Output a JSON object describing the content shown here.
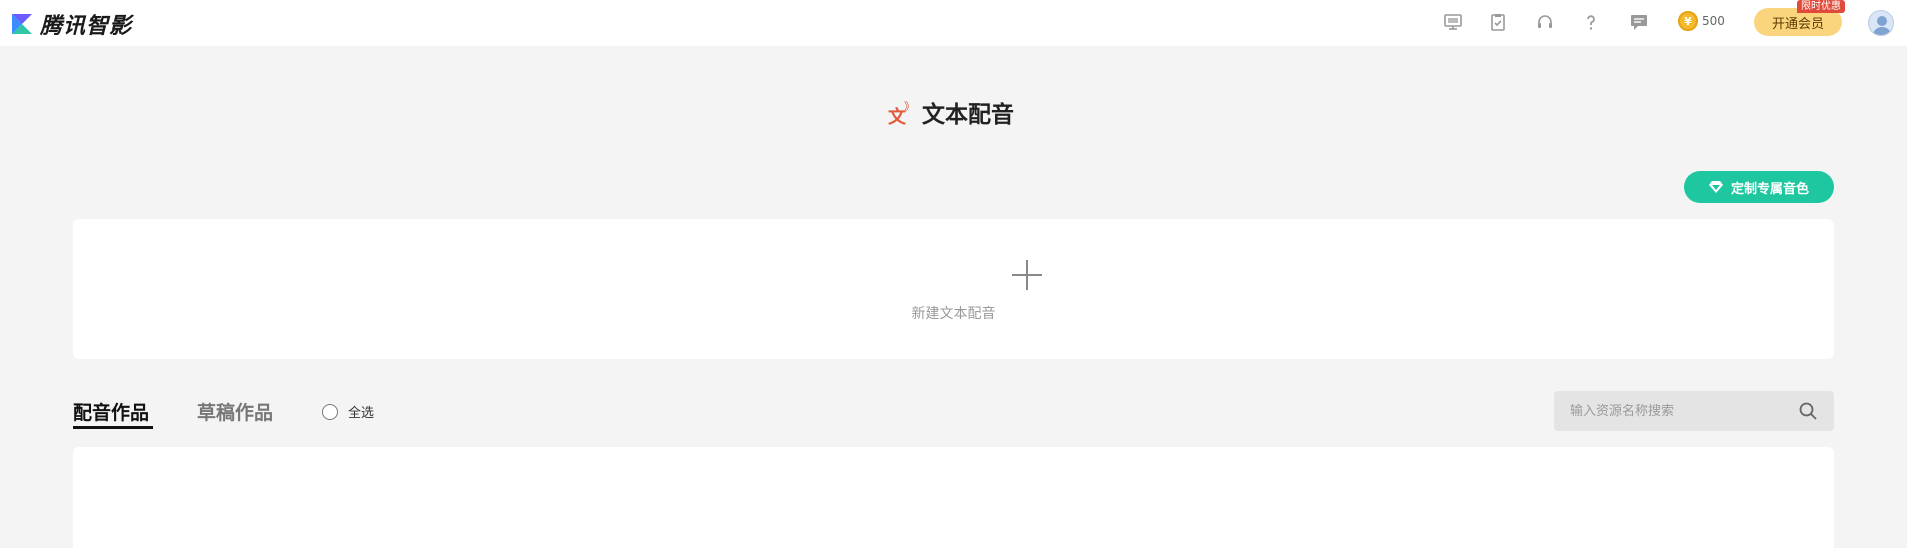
{
  "app": {
    "name": "腾讯智影"
  },
  "topbar": {
    "icons": [
      "monitor-icon",
      "clipboard-icon",
      "headset-icon",
      "help-icon",
      "message-icon"
    ],
    "coins": "500",
    "vip_button": "开通会员",
    "vip_tag": "限时优惠"
  },
  "page": {
    "title": "文本配音",
    "title_icon_glyph": "文",
    "custom_voice_button": "定制专属音色",
    "new_card_label": "新建文本配音"
  },
  "tabs": [
    {
      "label": "配音作品",
      "active": true
    },
    {
      "label": "草稿作品",
      "active": false
    }
  ],
  "select_all": "全选",
  "search": {
    "placeholder": "输入资源名称搜索"
  },
  "colors": {
    "accent_green": "#1fc7a0",
    "title_icon_red": "#e05a3c",
    "vip_gold": "#fbd57e",
    "vip_tag_red": "#e04a3a"
  }
}
